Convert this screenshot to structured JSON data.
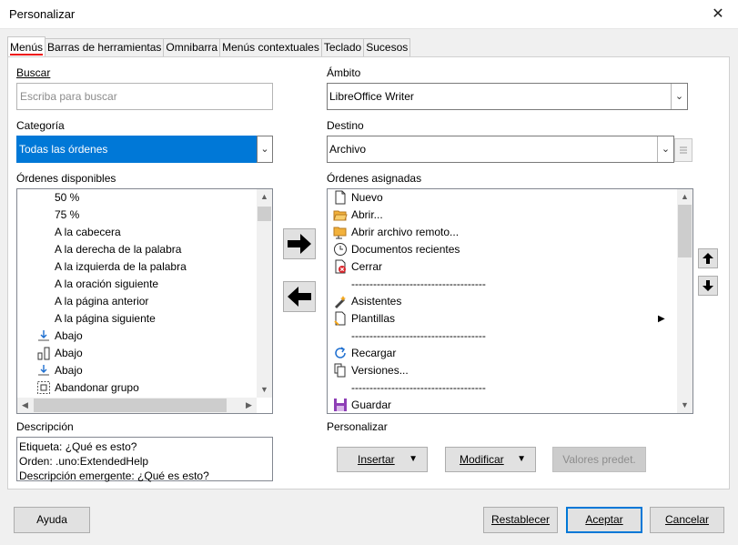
{
  "window": {
    "title": "Personalizar",
    "close_glyph": "✕"
  },
  "tabs": [
    {
      "label": "Menús",
      "active": true
    },
    {
      "label": "Barras de herramientas"
    },
    {
      "label": "Omnibarra"
    },
    {
      "label": "Menús contextuales"
    },
    {
      "label": "Teclado"
    },
    {
      "label": "Sucesos"
    }
  ],
  "search": {
    "label": "Buscar",
    "placeholder": "Escriba para buscar"
  },
  "category": {
    "label": "Categoría",
    "value": "Todas las órdenes"
  },
  "scope": {
    "label": "Ámbito",
    "value": "LibreOffice Writer"
  },
  "target": {
    "label": "Destino",
    "value": "Archivo"
  },
  "available": {
    "label": "Órdenes disponibles",
    "items": [
      {
        "text": "50 %",
        "icon": ""
      },
      {
        "text": "75 %",
        "icon": ""
      },
      {
        "text": "A la cabecera",
        "icon": ""
      },
      {
        "text": "A la derecha de la palabra",
        "icon": ""
      },
      {
        "text": "A la izquierda de la palabra",
        "icon": ""
      },
      {
        "text": "A la oración siguiente",
        "icon": ""
      },
      {
        "text": "A la página anterior",
        "icon": ""
      },
      {
        "text": "A la página siguiente",
        "icon": ""
      },
      {
        "text": "Abajo",
        "icon": "align-bottom-icon"
      },
      {
        "text": "Abajo",
        "icon": "bar-chart-icon"
      },
      {
        "text": "Abajo",
        "icon": "align-bottom-icon"
      },
      {
        "text": "Abandonar grupo",
        "icon": "leave-group-icon"
      }
    ]
  },
  "assigned": {
    "label": "Órdenes asignadas",
    "items": [
      {
        "text": "Nuevo",
        "icon": "new-document-icon"
      },
      {
        "text": "Abrir...",
        "icon": "open-folder-icon"
      },
      {
        "text": "Abrir archivo remoto...",
        "icon": "remote-folder-icon"
      },
      {
        "text": "Documentos recientes",
        "icon": "clock-icon"
      },
      {
        "text": "Cerrar",
        "icon": "close-document-icon"
      },
      {
        "text": "-------------------------------------",
        "icon": "separator"
      },
      {
        "text": "Asistentes",
        "icon": "wizard-icon"
      },
      {
        "text": "Plantillas",
        "icon": "templates-icon",
        "submenu": true
      },
      {
        "text": "-------------------------------------",
        "icon": "separator"
      },
      {
        "text": "Recargar",
        "icon": "reload-icon"
      },
      {
        "text": "Versiones...",
        "icon": "versions-icon"
      },
      {
        "text": "-------------------------------------",
        "icon": "separator"
      },
      {
        "text": "Guardar",
        "icon": "save-icon"
      }
    ]
  },
  "description": {
    "label": "Descripción",
    "lines": [
      "Etiqueta: ¿Qué es esto?",
      "Orden: .uno:ExtendedHelp",
      "Descripción emergente: ¿Qué es esto?"
    ]
  },
  "customize": {
    "label": "Personalizar",
    "insert": "Insertar",
    "modify": "Modificar",
    "defaults": "Valores predet."
  },
  "footer": {
    "help": "Ayuda",
    "reset": "Restablecer",
    "ok": "Aceptar",
    "cancel": "Cancelar"
  },
  "colors": {
    "accent": "#0078d7",
    "tab_underline": "#e11111"
  }
}
